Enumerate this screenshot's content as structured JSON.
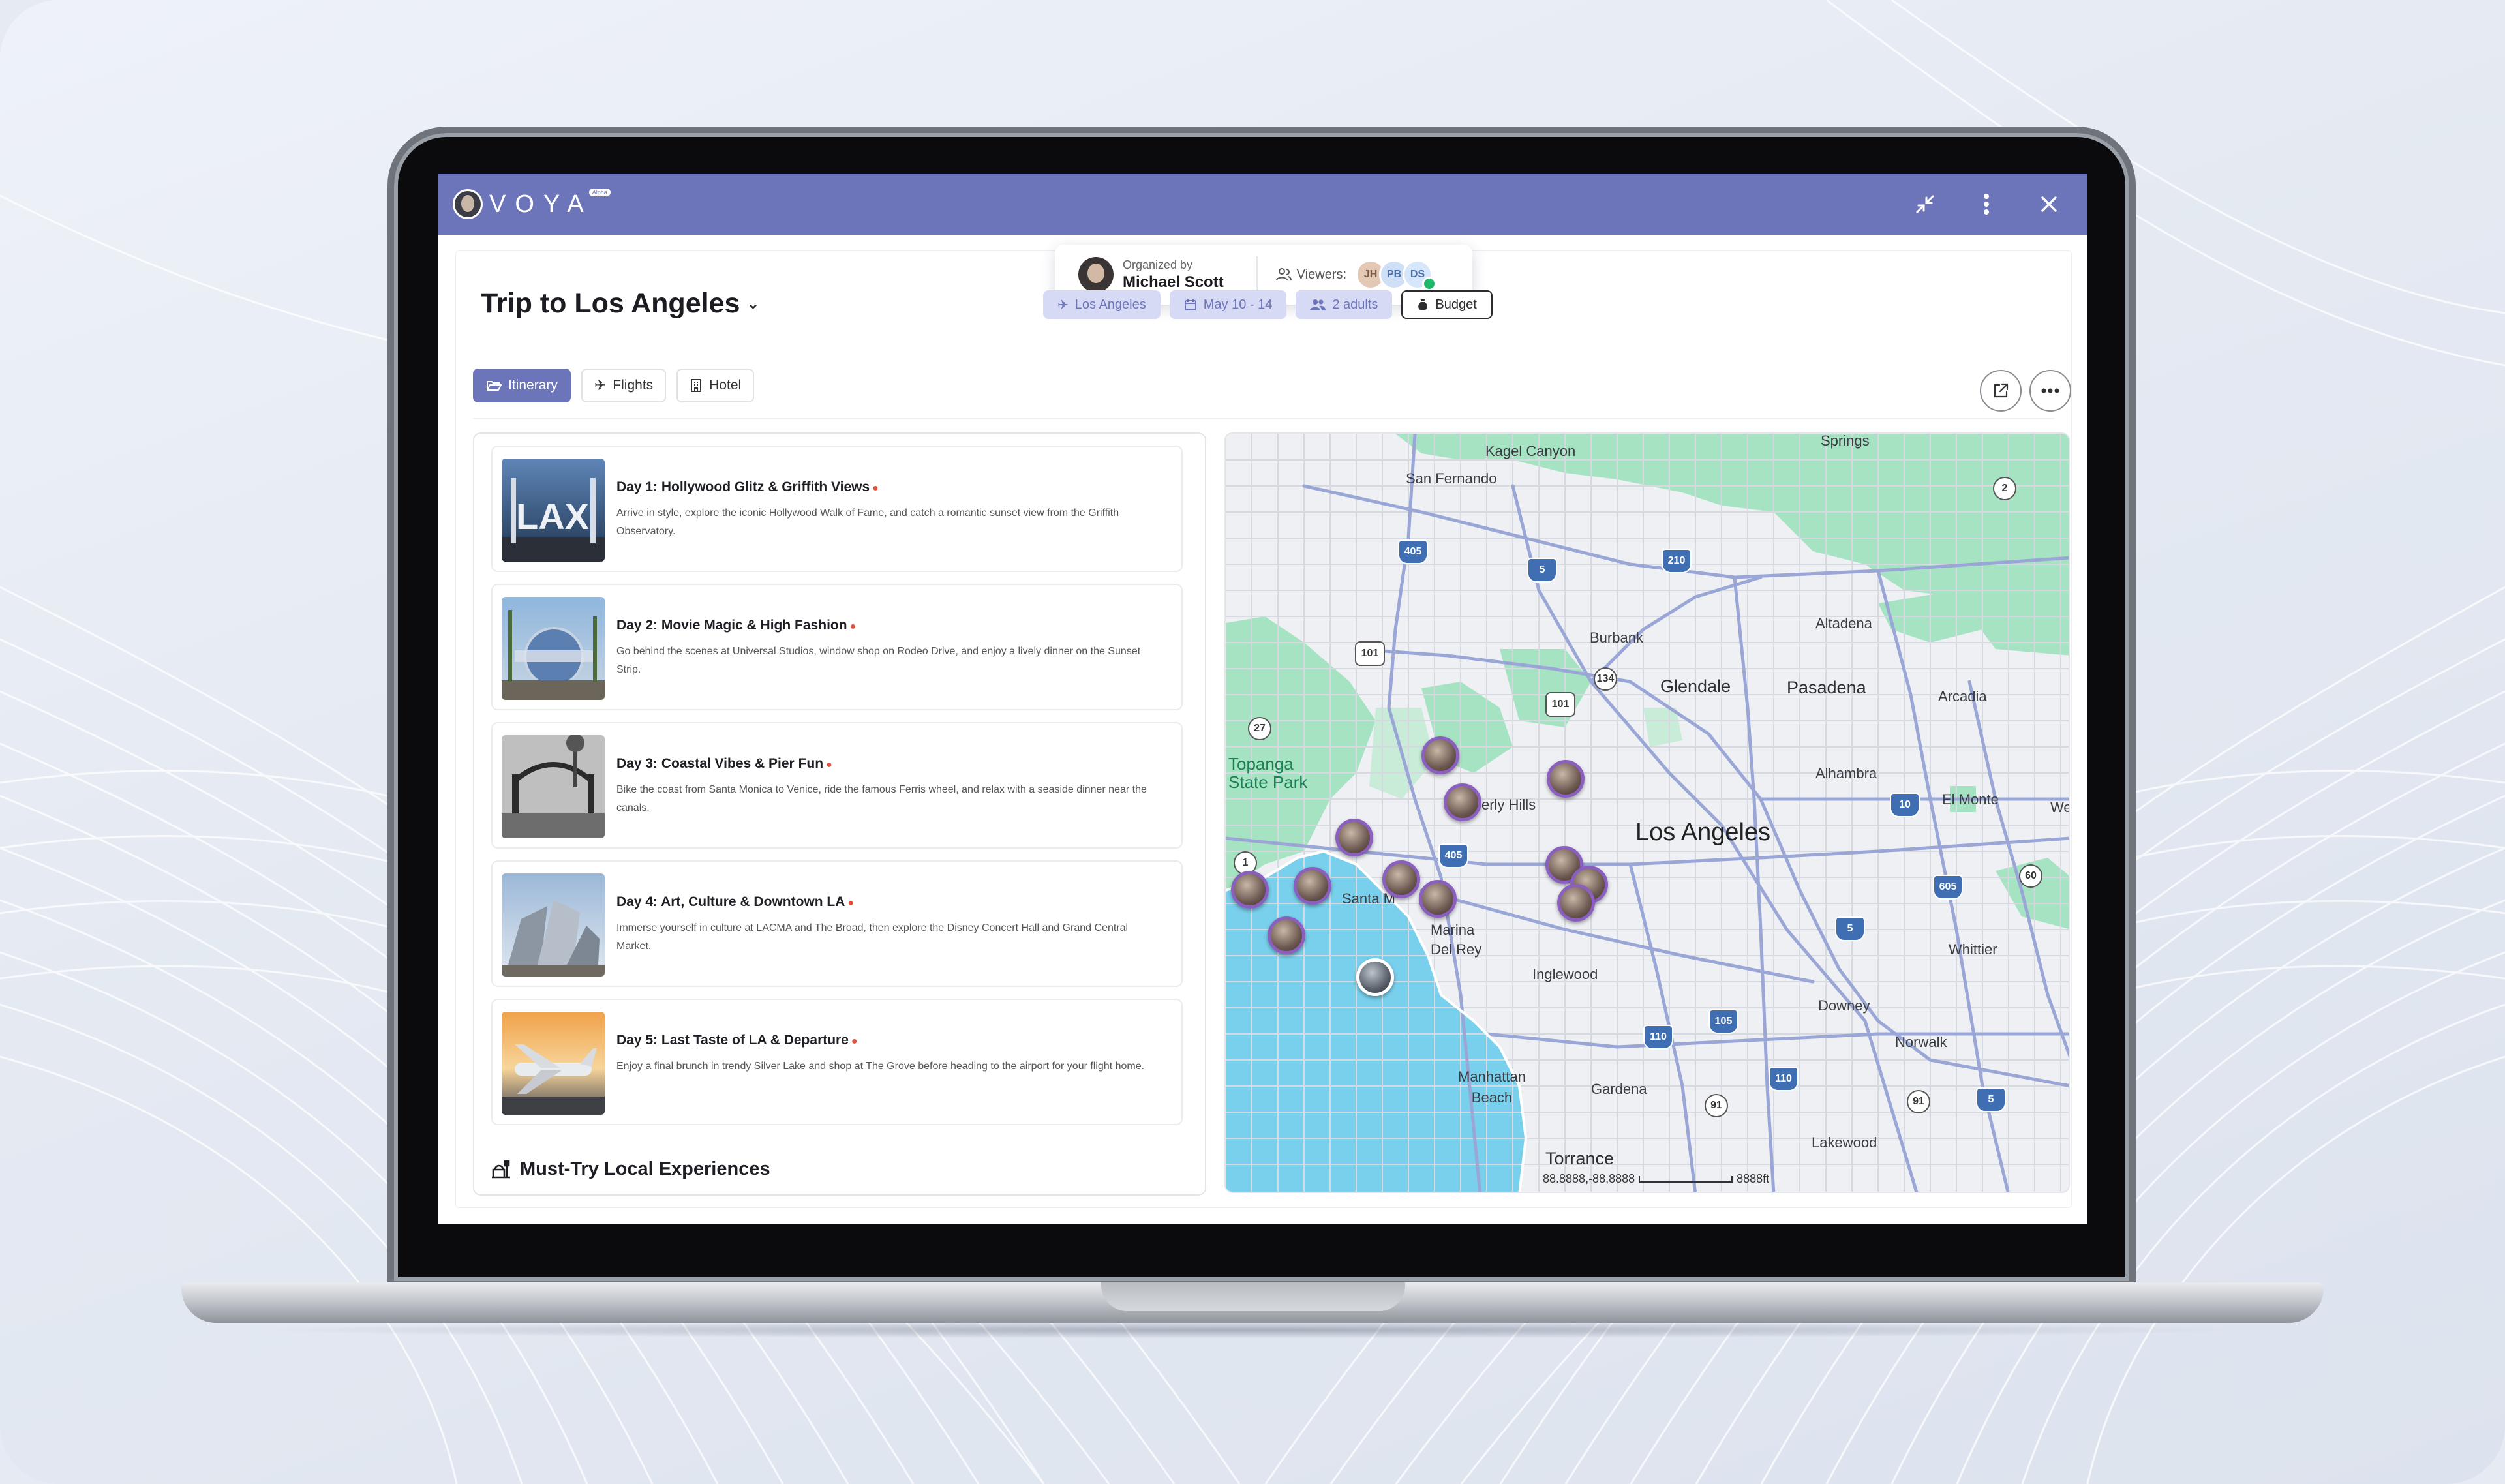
{
  "app": {
    "brand": "VOYA",
    "brand_badge": "Alpha"
  },
  "header_icons": {
    "minimize": "minimize-icon",
    "more": "more-vertical-icon",
    "close": "close-icon"
  },
  "trip": {
    "title": "Trip to Los Angeles",
    "organized_by_label": "Organized by",
    "organizer_name": "Michael Scott",
    "viewers_label": "Viewers:",
    "viewers": [
      "JH",
      "PB",
      "DS"
    ]
  },
  "chips": {
    "destination": "Los Angeles",
    "dates": "May 10 - 14",
    "travelers": "2 adults",
    "budget": "Budget"
  },
  "tabs": [
    {
      "label": "Itinerary",
      "active": true
    },
    {
      "label": "Flights",
      "active": false
    },
    {
      "label": "Hotel",
      "active": false
    }
  ],
  "days": [
    {
      "title": "Day 1: Hollywood Glitz & Griffith Views",
      "description": "Arrive in style, explore the iconic Hollywood Walk of Fame, and catch a romantic sunset view from the Griffith Observatory."
    },
    {
      "title": "Day 2: Movie Magic & High Fashion",
      "description": "Go behind the scenes at Universal Studios, window shop on Rodeo Drive, and enjoy a lively dinner on the Sunset Strip."
    },
    {
      "title": "Day 3: Coastal Vibes & Pier Fun",
      "description": "Bike the coast from Santa Monica to Venice, ride the famous Ferris wheel, and relax with a seaside dinner near the canals."
    },
    {
      "title": "Day 4: Art, Culture & Downtown LA",
      "description": "Immerse yourself in culture at LACMA and The Broad, then explore the Disney Concert Hall and Grand Central Market."
    },
    {
      "title": "Day 5: Last Taste of LA & Departure",
      "description": "Enjoy a final brunch in trendy Silver Lake and shop at The Grove before heading to the airport for your flight home."
    }
  ],
  "experiences_title": "Must-Try Local Experiences",
  "map": {
    "labels": {
      "kagel_canyon": "Kagel Canyon",
      "springs": "Springs",
      "san_fernando": "San Fernando",
      "burbank": "Burbank",
      "altadena": "Altadena",
      "glendale": "Glendale",
      "pasadena": "Pasadena",
      "arcadia": "Arcadia",
      "topanga": "Topanga\nState Park",
      "alhambra": "Alhambra",
      "el_monte": "El Monte",
      "west": "We",
      "beverly_hills": "erly Hills",
      "los_angeles": "Los Angeles",
      "santa_monica": "Santa M",
      "marina": "Marina\nDel Rey",
      "inglewood": "Inglewood",
      "whittier": "Whittier",
      "downey": "Downey",
      "norwalk": "Norwalk",
      "manhattan_beach": "Manhattan\nBeach",
      "gardena": "Gardena",
      "lakewood": "Lakewood",
      "torrance": "Torrance"
    },
    "shields": [
      "2",
      "405",
      "5",
      "210",
      "101",
      "134",
      "101",
      "27",
      "1",
      "405",
      "10",
      "605",
      "60",
      "5",
      "110",
      "105",
      "110",
      "91",
      "91",
      "5"
    ],
    "coordinates": "88.8888,-88,8888",
    "scale_label": "8888ft"
  }
}
